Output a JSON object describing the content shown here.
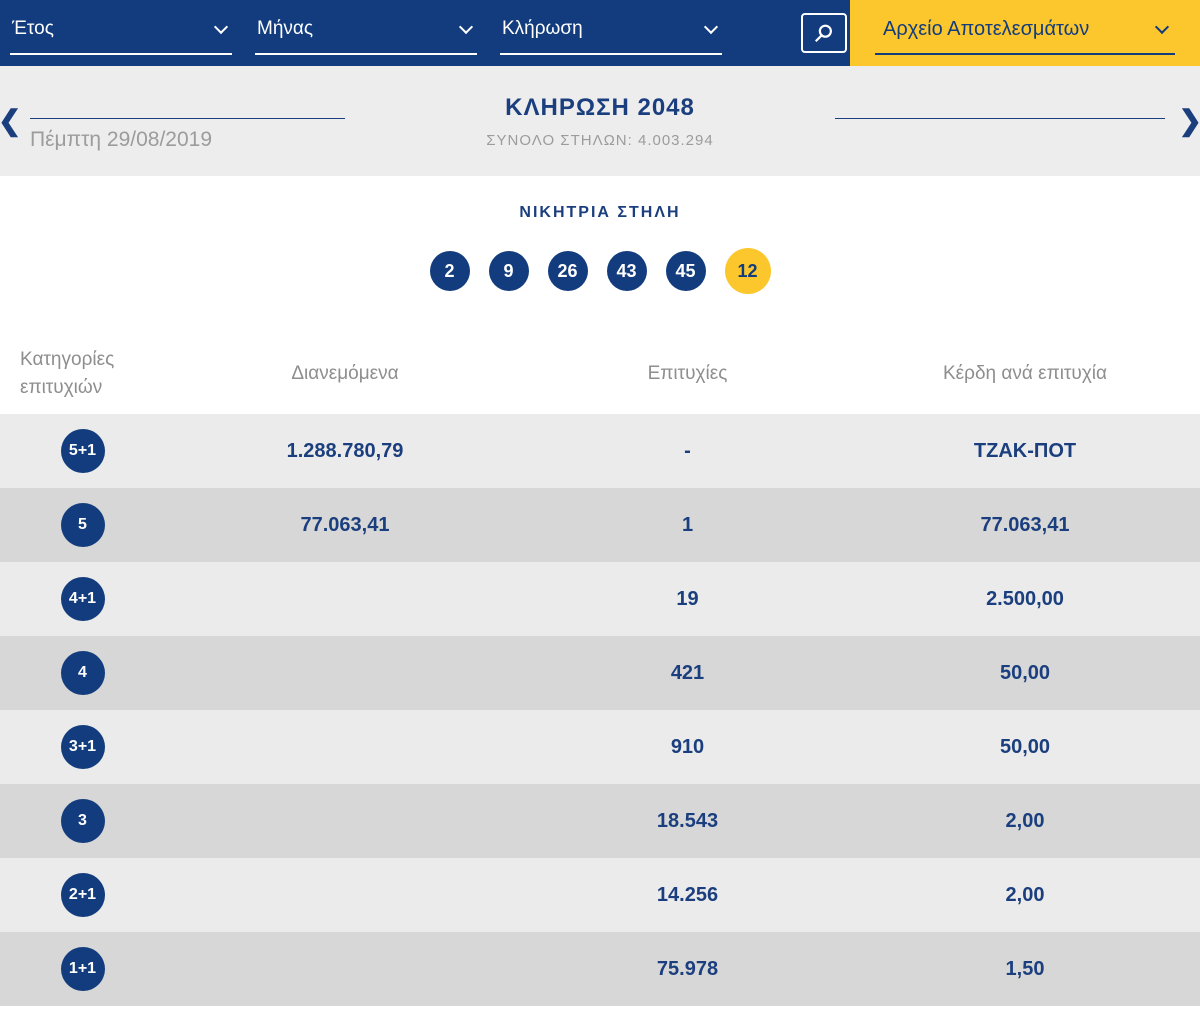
{
  "filters": {
    "year_label": "Έτος",
    "month_label": "Μήνας",
    "draw_label": "Κλήρωση",
    "archive_label": "Αρχείο Αποτελεσμάτων"
  },
  "header": {
    "prev_icon": "❮",
    "next_icon": "❯",
    "date": "Πέμπτη 29/08/2019",
    "draw_title": "ΚΛΗΡΩΣΗ 2048",
    "total_columns": "ΣΥΝΟΛΟ ΣΤΗΛΩΝ: 4.003.294"
  },
  "winning": {
    "title": "ΝΙΚΗΤΡΙΑ ΣΤΗΛΗ",
    "numbers": [
      "2",
      "9",
      "26",
      "43",
      "45"
    ],
    "joker": "12"
  },
  "table": {
    "headers": [
      "Κατηγορίες επιτυχιών",
      "Διανεμόμενα",
      "Επιτυχίες",
      "Κέρδη ανά επιτυχία"
    ],
    "rows": [
      {
        "category": "5+1",
        "distributed": "1.288.780,79",
        "winners": "-",
        "prize": "ΤΖΑΚ-ΠΟΤ"
      },
      {
        "category": "5",
        "distributed": "77.063,41",
        "winners": "1",
        "prize": "77.063,41"
      },
      {
        "category": "4+1",
        "distributed": "",
        "winners": "19",
        "prize": "2.500,00"
      },
      {
        "category": "4",
        "distributed": "",
        "winners": "421",
        "prize": "50,00"
      },
      {
        "category": "3+1",
        "distributed": "",
        "winners": "910",
        "prize": "50,00"
      },
      {
        "category": "3",
        "distributed": "",
        "winners": "18.543",
        "prize": "2,00"
      },
      {
        "category": "2+1",
        "distributed": "",
        "winners": "14.256",
        "prize": "2,00"
      },
      {
        "category": "1+1",
        "distributed": "",
        "winners": "75.978",
        "prize": "1,50"
      }
    ]
  },
  "colors": {
    "navy": "#123c7d",
    "textblue": "#1b3f7e",
    "yellow": "#fcc72c",
    "band": "#ededed",
    "rowlight": "#ebebeb",
    "rowdark": "#d7d7d7",
    "hdrgray": "#8e8e8e",
    "dategray": "#9c9c9c"
  }
}
